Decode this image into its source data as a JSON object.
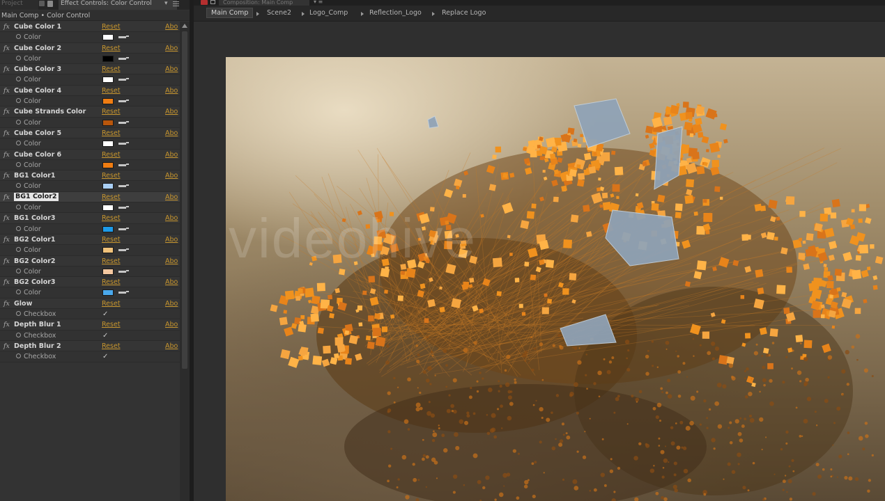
{
  "left_panel": {
    "tab_project": "Project",
    "tab_effect_controls": "Effect Controls: Color Control",
    "breadcrumb": "Main Comp • Color Control",
    "reset_label": "Reset",
    "about_label": "Abo",
    "effects": [
      {
        "name": "Cube Color 1",
        "prop": "Color",
        "type": "color",
        "color": "#ffffff"
      },
      {
        "name": "Cube Color 2",
        "prop": "Color",
        "type": "color",
        "color": "#000000"
      },
      {
        "name": "Cube Color 3",
        "prop": "Color",
        "type": "color",
        "color": "#ffffff"
      },
      {
        "name": "Cube Color 4",
        "prop": "Color",
        "type": "color",
        "color": "#f07d12"
      },
      {
        "name": "Cube Strands Color",
        "prop": "Color",
        "type": "color",
        "color": "#b8560c"
      },
      {
        "name": "Cube Color 5",
        "prop": "Color",
        "type": "color",
        "color": "#ffffff"
      },
      {
        "name": "Cube Color 6",
        "prop": "Color",
        "type": "color",
        "color": "#f07d12"
      },
      {
        "name": "BG1 Color1",
        "prop": "Color",
        "type": "color",
        "color": "#a9cff5"
      },
      {
        "name": "BG1 Color2",
        "prop": "Color",
        "type": "color",
        "color": "#ffffff",
        "selected": true
      },
      {
        "name": "BG1 Color3",
        "prop": "Color",
        "type": "color",
        "color": "#1e9be8"
      },
      {
        "name": "BG2 Color1",
        "prop": "Color",
        "type": "color",
        "color": "#f0c27a"
      },
      {
        "name": "BG2 Color2",
        "prop": "Color",
        "type": "color",
        "color": "#f5c8a0"
      },
      {
        "name": "BG2 Color3",
        "prop": "Color",
        "type": "color",
        "color": "#4aa8ec"
      },
      {
        "name": "Glow",
        "prop": "Checkbox",
        "type": "checkbox",
        "checked": true
      },
      {
        "name": "Depth Blur 1",
        "prop": "Checkbox",
        "type": "checkbox",
        "checked": true
      },
      {
        "name": "Depth Blur 2",
        "prop": "Checkbox",
        "type": "checkbox",
        "checked": true
      }
    ]
  },
  "composition": {
    "tab_title": "Composition: Main Comp",
    "flowchart": [
      "Main Comp",
      "Scene2",
      "Logo_Comp",
      "Reflection_Logo",
      "Replace Logo"
    ],
    "watermark": "videohive"
  },
  "colors": {
    "accent_link": "#c8962e",
    "panel_bg": "#333333",
    "orange": "#f08a1a"
  }
}
